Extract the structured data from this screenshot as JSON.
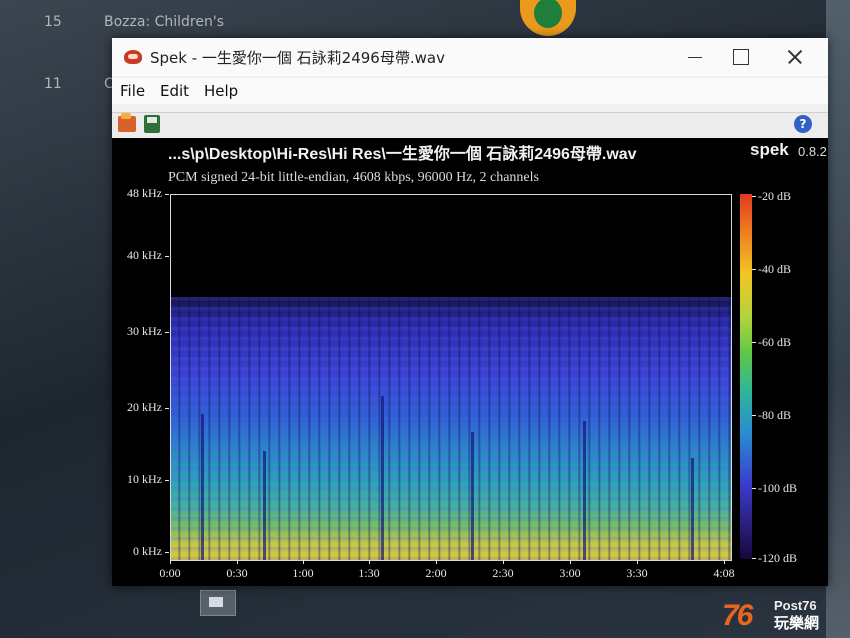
{
  "background": {
    "list_items": [
      {
        "num": "15",
        "title": "Bozza: Children's"
      },
      {
        "num": "11",
        "title": "C"
      }
    ],
    "watermark": {
      "num": "76",
      "en": "Post76",
      "zh": "玩樂網"
    }
  },
  "window": {
    "title": "Spek - 一生愛你一個 石詠莉2496母帶.wav",
    "controls": {
      "minimize": "minimize",
      "maximize": "maximize",
      "close": "close"
    },
    "menu": [
      "File",
      "Edit",
      "Help"
    ],
    "toolbar": {
      "open_icon": "open-file-icon",
      "save_icon": "save-icon",
      "help_icon": "?"
    }
  },
  "spek": {
    "file_path": "...s\\p\\Desktop\\Hi-Res\\Hi Res\\一生愛你一個 石詠莉2496母帶.wav",
    "app_name": "spek",
    "version": "0.8.2",
    "file_info": "PCM signed 24-bit little-endian, 4608 kbps, 96000 Hz, 2 channels",
    "freq_labels": [
      "48 kHz",
      "40 kHz",
      "30 kHz",
      "20 kHz",
      "10 kHz",
      "0 kHz"
    ],
    "time_labels": [
      "0:00",
      "0:30",
      "1:00",
      "1:30",
      "2:00",
      "2:30",
      "3:00",
      "3:30",
      "4:08"
    ],
    "db_labels": [
      "-20 dB",
      "-40 dB",
      "-60 dB",
      "-80 dB",
      "-100 dB",
      "-120 dB"
    ],
    "spectrum_cutoff_khz": 35,
    "duration": "4:08"
  }
}
